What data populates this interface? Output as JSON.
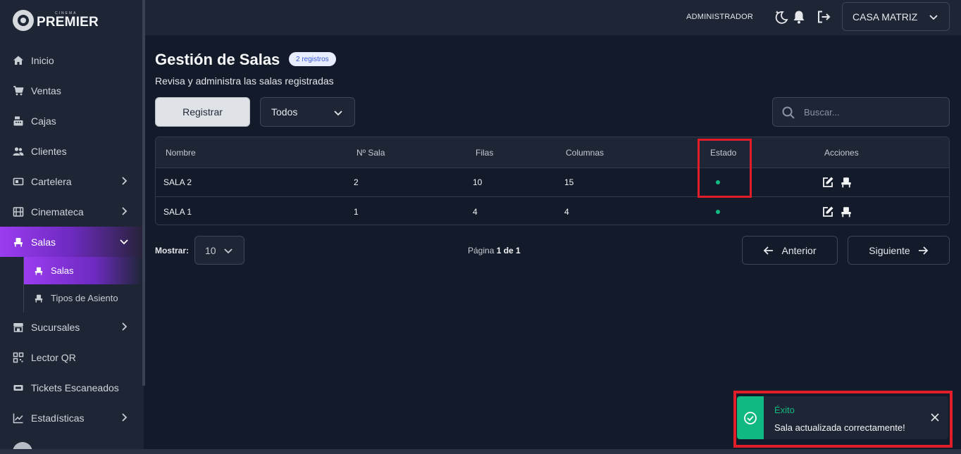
{
  "brand": {
    "small": "CINEMA",
    "name": "PREMIER"
  },
  "sidebar": {
    "items": [
      {
        "label": "Inicio",
        "icon": "home-icon"
      },
      {
        "label": "Ventas",
        "icon": "cart-icon"
      },
      {
        "label": "Cajas",
        "icon": "cash-register-icon"
      },
      {
        "label": "Clientes",
        "icon": "users-icon"
      },
      {
        "label": "Cartelera",
        "icon": "ticket-icon",
        "expandable": true
      },
      {
        "label": "Cinemateca",
        "icon": "film-icon",
        "expandable": true
      },
      {
        "label": "Salas",
        "icon": "seat-icon",
        "expanded": true,
        "active": true
      },
      {
        "label": "Sucursales",
        "icon": "store-icon",
        "expandable": true
      },
      {
        "label": "Lector QR",
        "icon": "qr-icon"
      },
      {
        "label": "Tickets Escaneados",
        "icon": "ticket-scan-icon"
      },
      {
        "label": "Estadísticas",
        "icon": "chart-icon",
        "expandable": true
      }
    ],
    "sub_items": [
      {
        "label": "Salas",
        "active": true
      },
      {
        "label": "Tipos de Asiento",
        "active": false
      }
    ]
  },
  "header": {
    "role": "ADMINISTRADOR",
    "branch": "CASA MATRIZ"
  },
  "page": {
    "title": "Gestión de Salas",
    "badge": "2 registros",
    "subtitle": "Revisa y administra las salas registradas",
    "register_label": "Registrar",
    "filter_value": "Todos",
    "search_placeholder": "Buscar..."
  },
  "table": {
    "columns": [
      "Nombre",
      "Nº Sala",
      "Filas",
      "Columnas",
      "Estado",
      "Acciones"
    ],
    "rows": [
      {
        "nombre": "SALA 2",
        "numero": "2",
        "filas": "10",
        "columnas": "15",
        "estado": "activo"
      },
      {
        "nombre": "SALA 1",
        "numero": "1",
        "filas": "4",
        "columnas": "4",
        "estado": "activo"
      }
    ]
  },
  "pagination": {
    "show_label": "Mostrar:",
    "page_size": "10",
    "page_prefix": "Página ",
    "page_current": "1 de 1",
    "prev_label": "Anterior",
    "next_label": "Siguiente"
  },
  "toast": {
    "title": "Éxito",
    "message": "Sala actualizada correctamente!"
  },
  "colors": {
    "accent": "#9b3cf0",
    "success": "#10b981",
    "highlight": "#e11d2a",
    "background": "#131a2a",
    "panel": "#1e2636"
  }
}
